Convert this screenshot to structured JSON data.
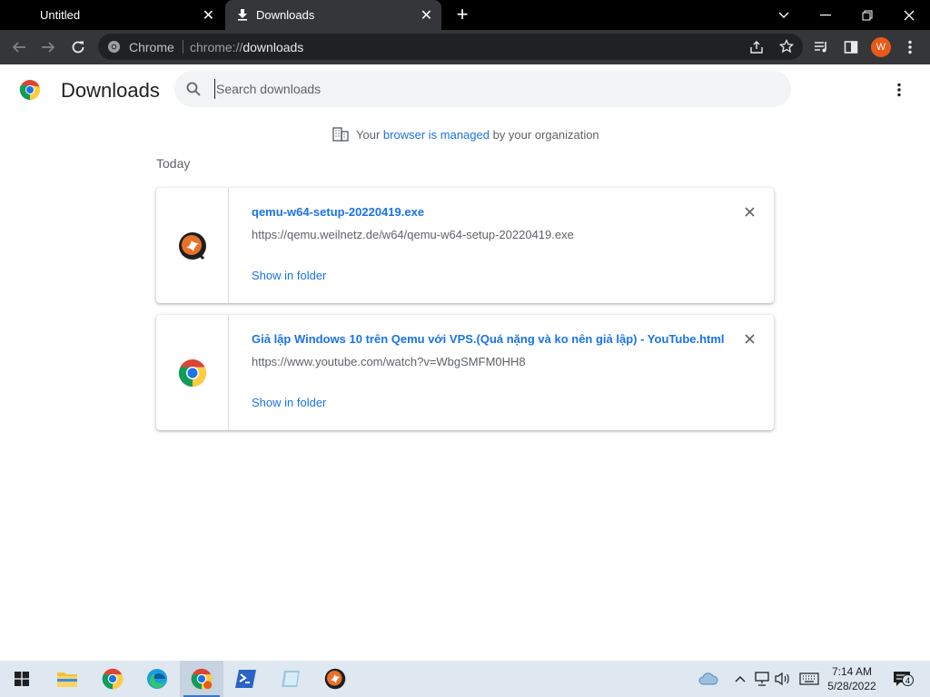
{
  "tabs": [
    {
      "label": "Untitled"
    },
    {
      "label": "Downloads"
    }
  ],
  "omnibox": {
    "site_label": "Chrome",
    "url_prefix": "chrome://",
    "url_host": "downloads"
  },
  "profile": {
    "initial": "W"
  },
  "page": {
    "title": "Downloads",
    "search_placeholder": "Search downloads",
    "managed_prefix": "Your ",
    "managed_link": "browser is managed",
    "managed_suffix": " by your organization",
    "date_group": "Today"
  },
  "downloads": [
    {
      "name": "qemu-w64-setup-20220419.exe",
      "url": "https://qemu.weilnetz.de/w64/qemu-w64-setup-20220419.exe",
      "action": "Show in folder",
      "icon": "qemu-icon"
    },
    {
      "name": "Giả lập Windows 10 trên Qemu với VPS.(Quá nặng và ko nên giả lập) - YouTube.html",
      "url": "https://www.youtube.com/watch?v=WbgSMFM0HH8",
      "action": "Show in folder",
      "icon": "chrome-icon"
    }
  ],
  "taskbar": {
    "time": "7:14 AM",
    "date": "5/28/2022",
    "notification_count": "4"
  },
  "colors": {
    "accent": "#1a73e8",
    "avatar": "#e8591a",
    "toolbar": "#35363a"
  }
}
